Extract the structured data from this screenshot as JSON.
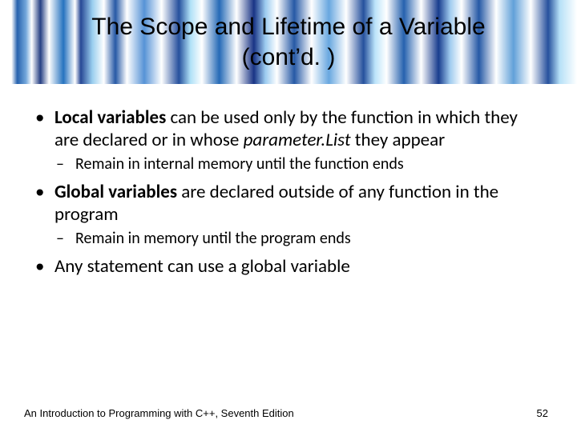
{
  "title": {
    "line1": "The Scope and Lifetime of a Variable",
    "line2": "(cont’d. )"
  },
  "bullets": [
    {
      "bold": "Local variables",
      "rest1": " can be used only by the function in which they are declared or in whose ",
      "italic": "parameter.List",
      "rest2": " they appear",
      "sub": [
        "Remain in internal memory until the function ends"
      ]
    },
    {
      "bold": "Global variables",
      "rest1": " are declared outside of any function in the program",
      "sub": [
        "Remain in memory until the program ends"
      ]
    },
    {
      "rest1": " Any statement can use a global variable"
    }
  ],
  "footer": {
    "text": "An Introduction to Programming with C++, Seventh Edition",
    "page": "52"
  }
}
